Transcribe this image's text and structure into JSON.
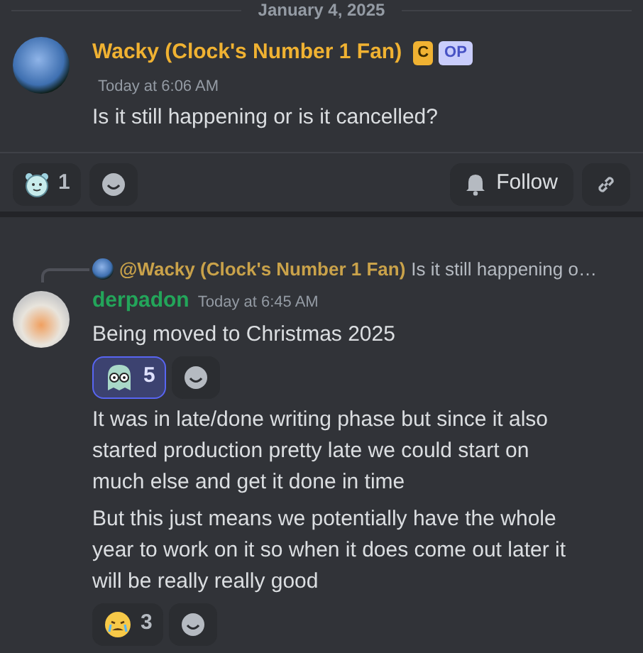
{
  "date_divider": "January 4, 2025",
  "post": {
    "author": "Wacky (Clock's Number 1 Fan)",
    "color": "#f0b232",
    "badges": [
      {
        "kind": "role",
        "text": "C"
      },
      {
        "kind": "op",
        "text": "OP"
      }
    ],
    "timestamp": "Today at 6:06 AM",
    "content": "Is it still happening or is it cancelled?",
    "reactions": [
      {
        "kind": "clock",
        "count": "1",
        "selected": false
      }
    ],
    "actions": [
      {
        "kind": "follow",
        "label": "Follow"
      },
      {
        "kind": "link"
      }
    ]
  },
  "reply": {
    "reply_to": {
      "author": "@Wacky (Clock's Number 1 Fan)",
      "color": "#c9a24a",
      "excerpt": "Is it still happening o…"
    },
    "author": "derpadon",
    "color": "#23a55a",
    "timestamp": "Today at 6:45 AM",
    "blocks": [
      {
        "lines": [
          "Being moved to Christmas 2025"
        ],
        "reactions": [
          {
            "kind": "ghost",
            "count": "5",
            "selected": true
          }
        ]
      },
      {
        "lines": [
          "It was in late/done writing phase but since it also started production pretty late we could start on much else and get it done in time",
          "But this just means we potentially have the whole year to work on it so when it does come out later it will be really really good"
        ],
        "reactions": [
          {
            "kind": "crying",
            "count": "3",
            "selected": false
          }
        ]
      }
    ]
  }
}
